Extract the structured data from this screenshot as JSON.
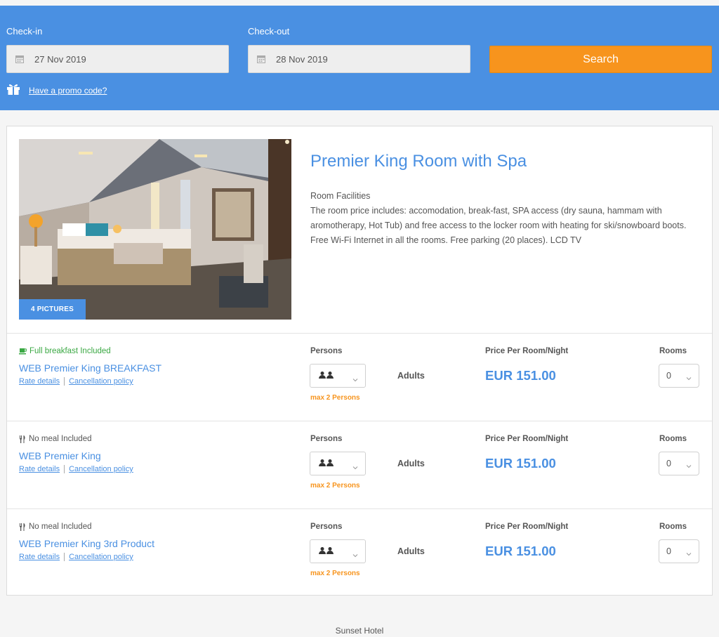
{
  "search": {
    "checkin_label": "Check-in",
    "checkin_value": "27 Nov 2019",
    "checkout_label": "Check-out",
    "checkout_value": "28 Nov 2019",
    "search_label": "Search",
    "promo_label": "Have a promo code?",
    "calendar_icon": "calendar-icon",
    "gift_icon": "gift-icon"
  },
  "room": {
    "title": "Premier King Room with Spa",
    "pictures_label": "4 PICTURES",
    "facilities_title": "Room Facilities",
    "facilities_text": "The room price includes: accomodation, break-fast, SPA access (dry sauna, hammam with aromotherapy, Hot Tub) and free access to the locker room with heating for ski/snowboard boots. Free Wi-Fi Internet in all the rooms. Free parking (20 places). LCD TV"
  },
  "rates": [
    {
      "meal": "Full breakfast Included",
      "meal_icon": "coffee-cup-icon",
      "name": "WEB Premier King BREAKFAST",
      "rate_details": "Rate details",
      "cancellation": "Cancellation policy",
      "persons_label": "Persons",
      "adults_label": "Adults",
      "max_persons": "max 2 Persons",
      "price_label": "Price Per Room/Night",
      "price": "EUR 151.00",
      "rooms_label": "Rooms",
      "rooms_value": "0"
    },
    {
      "meal": "No meal Included",
      "meal_icon": "cutlery-icon",
      "name": "WEB Premier King",
      "rate_details": "Rate details",
      "cancellation": "Cancellation policy",
      "persons_label": "Persons",
      "adults_label": "Adults",
      "max_persons": "max 2 Persons",
      "price_label": "Price Per Room/Night",
      "price": "EUR 151.00",
      "rooms_label": "Rooms",
      "rooms_value": "0"
    },
    {
      "meal": "No meal Included",
      "meal_icon": "cutlery-icon",
      "name": "WEB Premier King 3rd Product",
      "rate_details": "Rate details",
      "cancellation": "Cancellation policy",
      "persons_label": "Persons",
      "adults_label": "Adults",
      "max_persons": "max 2 Persons",
      "price_label": "Price Per Room/Night",
      "price": "EUR 151.00",
      "rooms_label": "Rooms",
      "rooms_value": "0"
    }
  ],
  "footer": {
    "hotel_name": "Sunset Hotel"
  },
  "colors": {
    "accent_blue": "#4a90e2",
    "search_orange": "#f7941d",
    "breakfast_green": "#3aa843"
  }
}
